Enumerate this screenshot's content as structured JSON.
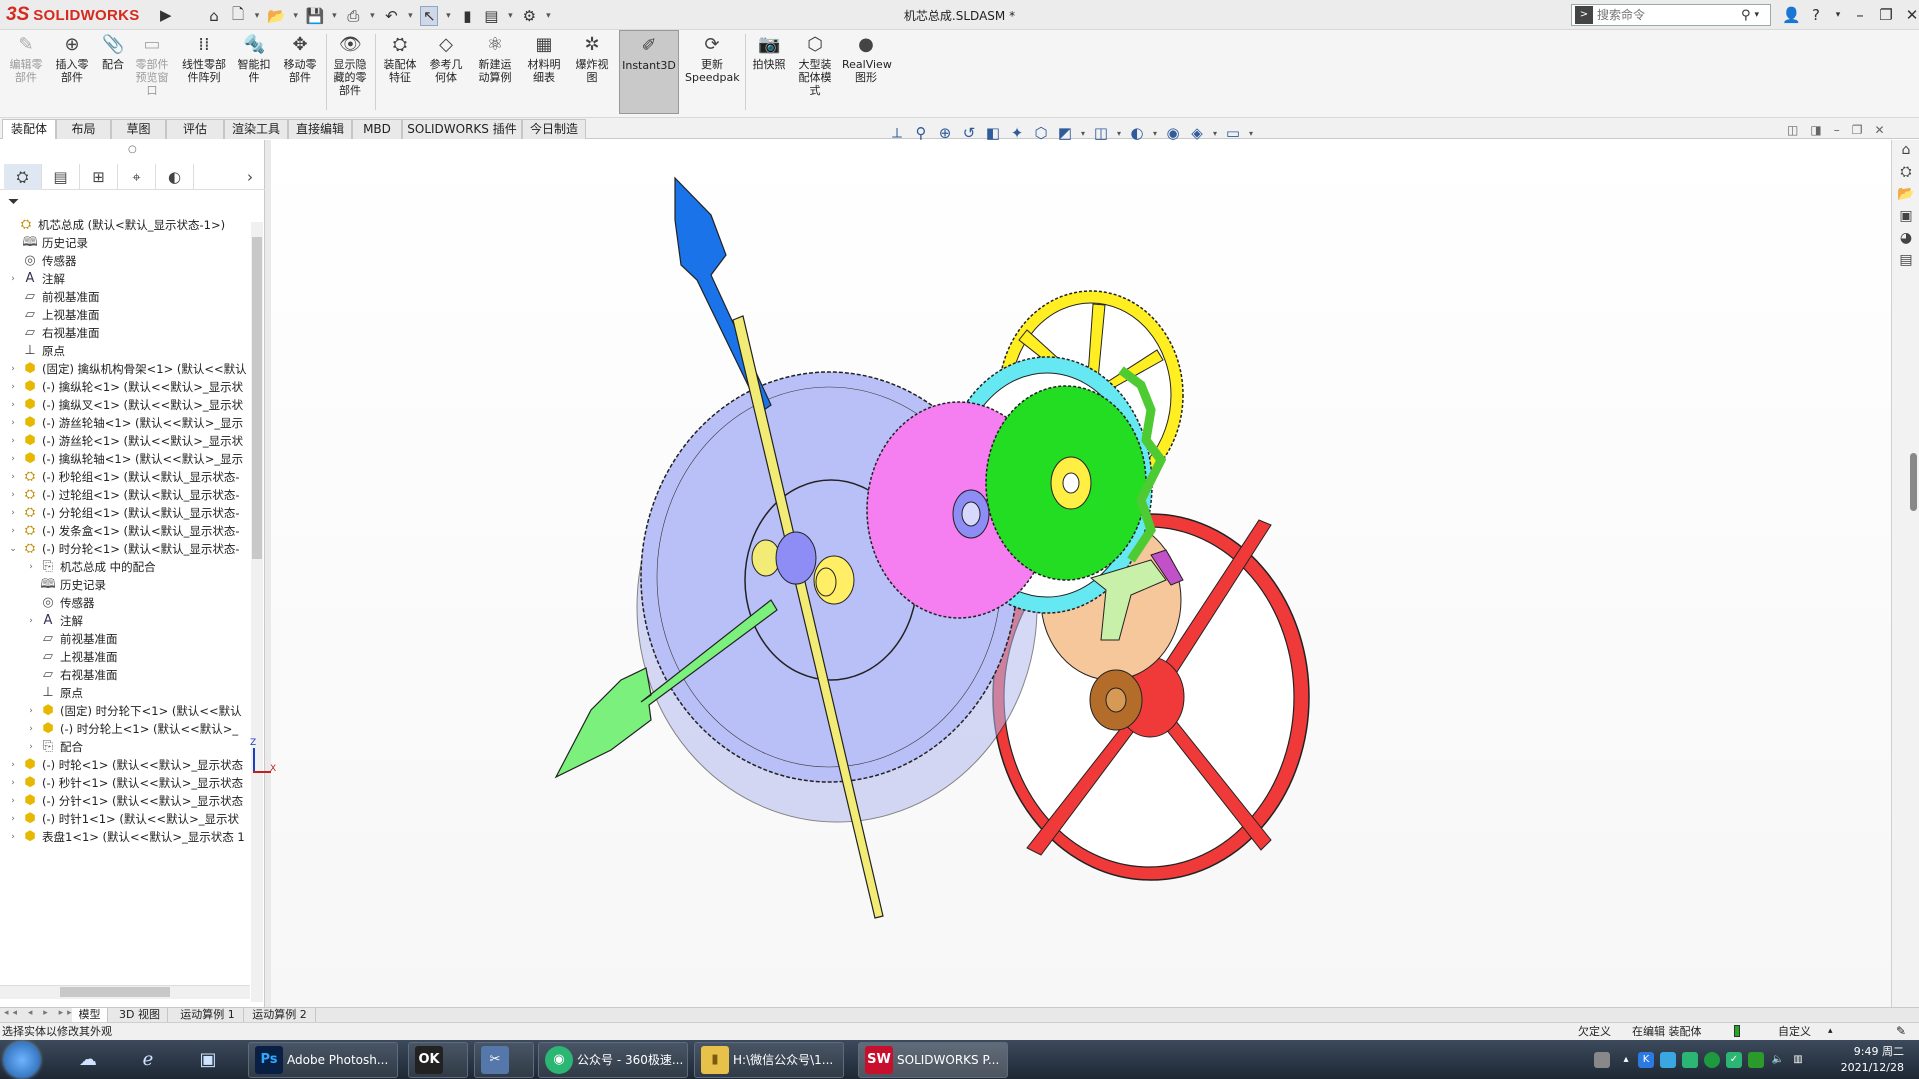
{
  "app": {
    "logo_ds": "3S",
    "logo_name": "SOLIDWORKS",
    "document_title": "机芯总成.SLDASM *"
  },
  "search": {
    "placeholder": "搜索命令"
  },
  "ribbon": {
    "buttons": [
      {
        "label": "编辑零部件",
        "icon": "edit-component-icon",
        "disabled": true
      },
      {
        "label": "插入零部件",
        "icon": "insert-component-icon"
      },
      {
        "label": "配合",
        "icon": "mate-icon"
      },
      {
        "label": "零部件预览窗口",
        "icon": "component-preview-icon",
        "disabled": true
      },
      {
        "label": "线性零部件阵列",
        "icon": "linear-pattern-icon"
      },
      {
        "label": "智能扣件",
        "icon": "smart-fastener-icon"
      },
      {
        "label": "移动零部件",
        "icon": "move-component-icon"
      },
      {
        "label": "显示隐藏的零部件",
        "icon": "show-hidden-icon"
      },
      {
        "label": "装配体特征",
        "icon": "assembly-feature-icon"
      },
      {
        "label": "参考几何体",
        "icon": "reference-geometry-icon"
      },
      {
        "label": "新建运动算例",
        "icon": "motion-study-icon"
      },
      {
        "label": "材料明细表",
        "icon": "bom-icon"
      },
      {
        "label": "爆炸视图",
        "icon": "exploded-view-icon"
      },
      {
        "label": "Instant3D",
        "icon": "instant3d-icon",
        "active": true
      },
      {
        "label": "更新Speedpak",
        "icon": "speedpak-icon"
      },
      {
        "label": "拍快照",
        "icon": "snapshot-icon"
      },
      {
        "label": "大型装配体模式",
        "icon": "large-assembly-icon"
      },
      {
        "label": "RealView图形",
        "icon": "realview-icon"
      }
    ]
  },
  "command_tabs": [
    "装配体",
    "布局",
    "草图",
    "评估",
    "渲染工具",
    "直接编辑",
    "MBD",
    "SOLIDWORKS 插件",
    "今日制造"
  ],
  "tree": {
    "root": "机芯总成 (默认<默认_显示状态-1>)",
    "items": [
      {
        "level": 1,
        "expander": "",
        "icon": "history-icon",
        "label": "历史记录"
      },
      {
        "level": 1,
        "expander": "",
        "icon": "sensor-icon",
        "label": "传感器"
      },
      {
        "level": 1,
        "expander": "›",
        "icon": "annotation-icon",
        "label": "注解"
      },
      {
        "level": 1,
        "expander": "",
        "icon": "plane-icon",
        "label": "前视基准面"
      },
      {
        "level": 1,
        "expander": "",
        "icon": "plane-icon",
        "label": "上视基准面"
      },
      {
        "level": 1,
        "expander": "",
        "icon": "plane-icon",
        "label": "右视基准面"
      },
      {
        "level": 1,
        "expander": "",
        "icon": "origin-icon",
        "label": "原点"
      },
      {
        "level": 1,
        "expander": "›",
        "icon": "part-icon",
        "label": "(固定) 擒纵机构骨架<1> (默认<<默认"
      },
      {
        "level": 1,
        "expander": "›",
        "icon": "part-icon",
        "label": "(-) 擒纵轮<1> (默认<<默认>_显示状"
      },
      {
        "level": 1,
        "expander": "›",
        "icon": "part-icon",
        "label": "(-) 擒纵叉<1> (默认<<默认>_显示状"
      },
      {
        "level": 1,
        "expander": "›",
        "icon": "part-icon",
        "label": "(-) 游丝轮轴<1> (默认<<默认>_显示"
      },
      {
        "level": 1,
        "expander": "›",
        "icon": "part-icon",
        "label": "(-) 游丝轮<1> (默认<<默认>_显示状"
      },
      {
        "level": 1,
        "expander": "›",
        "icon": "part-icon",
        "label": "(-) 擒纵轮轴<1> (默认<<默认>_显示"
      },
      {
        "level": 1,
        "expander": "›",
        "icon": "subassembly-icon",
        "label": "(-) 秒轮组<1> (默认<默认_显示状态-"
      },
      {
        "level": 1,
        "expander": "›",
        "icon": "subassembly-icon",
        "label": "(-) 过轮组<1> (默认<默认_显示状态-"
      },
      {
        "level": 1,
        "expander": "›",
        "icon": "subassembly-icon",
        "label": "(-) 分轮组<1> (默认<默认_显示状态-"
      },
      {
        "level": 1,
        "expander": "›",
        "icon": "subassembly-icon",
        "label": "(-) 发条盒<1> (默认<默认_显示状态-"
      },
      {
        "level": 1,
        "expander": "⌄",
        "icon": "subassembly-icon",
        "label": "(-) 时分轮<1> (默认<默认_显示状态-"
      },
      {
        "level": 2,
        "expander": "›",
        "icon": "mates-folder-icon",
        "label": "机芯总成 中的配合"
      },
      {
        "level": 2,
        "expander": "",
        "icon": "history-icon",
        "label": "历史记录"
      },
      {
        "level": 2,
        "expander": "",
        "icon": "sensor-icon",
        "label": "传感器"
      },
      {
        "level": 2,
        "expander": "›",
        "icon": "annotation-icon",
        "label": "注解"
      },
      {
        "level": 2,
        "expander": "",
        "icon": "plane-icon",
        "label": "前视基准面"
      },
      {
        "level": 2,
        "expander": "",
        "icon": "plane-icon",
        "label": "上视基准面"
      },
      {
        "level": 2,
        "expander": "",
        "icon": "plane-icon",
        "label": "右视基准面"
      },
      {
        "level": 2,
        "expander": "",
        "icon": "origin-icon",
        "label": "原点"
      },
      {
        "level": 2,
        "expander": "›",
        "icon": "part-icon",
        "label": "(固定) 时分轮下<1> (默认<<默认"
      },
      {
        "level": 2,
        "expander": "›",
        "icon": "part-icon",
        "label": "(-) 时分轮上<1> (默认<<默认>_"
      },
      {
        "level": 2,
        "expander": "›",
        "icon": "mates-icon",
        "label": "配合"
      },
      {
        "level": 1,
        "expander": "›",
        "icon": "part-icon",
        "label": "(-) 时轮<1> (默认<<默认>_显示状态"
      },
      {
        "level": 1,
        "expander": "›",
        "icon": "part-icon",
        "label": "(-) 秒针<1> (默认<<默认>_显示状态"
      },
      {
        "level": 1,
        "expander": "›",
        "icon": "part-icon",
        "label": "(-) 分针<1> (默认<<默认>_显示状态"
      },
      {
        "level": 1,
        "expander": "›",
        "icon": "part-icon",
        "label": "(-) 时针1<1> (默认<<默认>_显示状"
      },
      {
        "level": 1,
        "expander": "›",
        "icon": "part-icon",
        "label": "表盘1<1> (默认<<默认>_显示状态 1"
      }
    ]
  },
  "triad": {
    "z": "Z",
    "x": "X"
  },
  "bottom_tabs": [
    "模型",
    "3D 视图",
    "运动算例 1",
    "运动算例 2"
  ],
  "status": {
    "message": "选择实体以修改其外观",
    "underdefined": "欠定义",
    "editing": "在编辑 装配体",
    "custom": "自定义"
  },
  "taskbar": {
    "apps": [
      {
        "label": "Adobe Photosh...",
        "icon": "photoshop-icon",
        "icon_text": "Ps"
      },
      {
        "label": "",
        "icon": "obs-icon",
        "icon_text": "OK"
      },
      {
        "label": "",
        "icon": "tool-icon",
        "icon_text": "✂"
      },
      {
        "label": "公众号 - 360极速...",
        "icon": "browser-360-icon",
        "icon_text": "◉"
      },
      {
        "label": "H:\\微信公众号\\1...",
        "icon": "folder-icon",
        "icon_text": "▮"
      },
      {
        "label": "SOLIDWORKS P...",
        "icon": "solidworks-icon",
        "icon_text": "SW"
      }
    ],
    "time": "9:49 周二",
    "date": "2021/12/28"
  },
  "colors": {
    "gear_yellow": "#ffee22",
    "gear_blue": "#b9c0f7",
    "gear_cyan": "#66e8f2",
    "gear_magenta": "#f57ef0",
    "gear_green": "#22dd22",
    "wheel_red": "#f03a3a",
    "hand_blue": "#1a73e8",
    "hand_green": "#7cf07c",
    "hand_yellow": "#f2ec76"
  }
}
